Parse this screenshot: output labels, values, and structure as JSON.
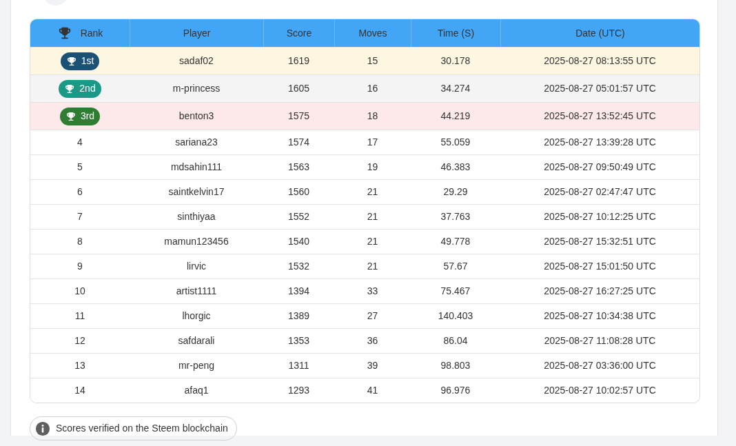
{
  "table": {
    "columns": [
      {
        "label": "Rank",
        "kind": "trophy"
      },
      {
        "label": "Player",
        "kind": "text"
      },
      {
        "label": "Score",
        "kind": "text"
      },
      {
        "label": "Moves",
        "kind": "text"
      },
      {
        "label": "Time (S)",
        "kind": "text"
      },
      {
        "label": "Date (UTC)",
        "kind": "text"
      }
    ],
    "rows": [
      {
        "kind": "gold",
        "rank": "1st",
        "player": "sadaf02",
        "score": "1619",
        "moves": "15",
        "time": "30.178",
        "date": "2025-08-27 08:13:55 UTC"
      },
      {
        "kind": "silver",
        "rank": "2nd",
        "player": "m-princess",
        "score": "1605",
        "moves": "16",
        "time": "34.274",
        "date": "2025-08-27 05:01:57 UTC"
      },
      {
        "kind": "bronze",
        "rank": "3rd",
        "player": "benton3",
        "score": "1575",
        "moves": "18",
        "time": "44.219",
        "date": "2025-08-27 13:52:45 UTC"
      },
      {
        "kind": "plain",
        "rank": "4",
        "player": "sariana23",
        "score": "1574",
        "moves": "17",
        "time": "55.059",
        "date": "2025-08-27 13:39:28 UTC"
      },
      {
        "kind": "plain",
        "rank": "5",
        "player": "mdsahin111",
        "score": "1563",
        "moves": "19",
        "time": "46.383",
        "date": "2025-08-27 09:50:49 UTC"
      },
      {
        "kind": "plain",
        "rank": "6",
        "player": "saintkelvin17",
        "score": "1560",
        "moves": "21",
        "time": "29.29",
        "date": "2025-08-27 02:47:47 UTC"
      },
      {
        "kind": "plain",
        "rank": "7",
        "player": "sinthiyaa",
        "score": "1552",
        "moves": "21",
        "time": "37.763",
        "date": "2025-08-27 10:12:25 UTC"
      },
      {
        "kind": "plain",
        "rank": "8",
        "player": "mamun123456",
        "score": "1540",
        "moves": "21",
        "time": "49.778",
        "date": "2025-08-27 15:32:51 UTC"
      },
      {
        "kind": "plain",
        "rank": "9",
        "player": "lirvic",
        "score": "1532",
        "moves": "21",
        "time": "57.67",
        "date": "2025-08-27 15:01:50 UTC"
      },
      {
        "kind": "plain",
        "rank": "10",
        "player": "artist1111",
        "score": "1394",
        "moves": "33",
        "time": "75.467",
        "date": "2025-08-27 16:27:25 UTC"
      },
      {
        "kind": "plain",
        "rank": "11",
        "player": "lhorgic",
        "score": "1389",
        "moves": "27",
        "time": "140.403",
        "date": "2025-08-27 10:34:38 UTC"
      },
      {
        "kind": "plain",
        "rank": "12",
        "player": "safdarali",
        "score": "1353",
        "moves": "36",
        "time": "86.04",
        "date": "2025-08-27 11:08:28 UTC"
      },
      {
        "kind": "plain",
        "rank": "13",
        "player": "mr-peng",
        "score": "1311",
        "moves": "39",
        "time": "98.803",
        "date": "2025-08-27 03:36:00 UTC"
      },
      {
        "kind": "plain",
        "rank": "14",
        "player": "afaq1",
        "score": "1293",
        "moves": "41",
        "time": "96.976",
        "date": "2025-08-27 10:02:57 UTC"
      }
    ]
  },
  "footer": {
    "note": "Scores verified on the Steem blockchain"
  }
}
